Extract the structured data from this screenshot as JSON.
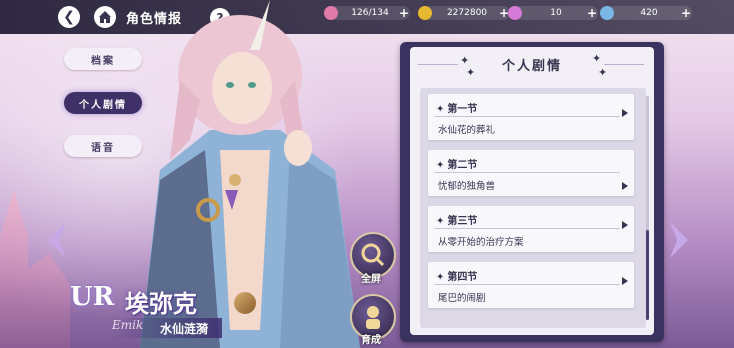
{
  "header": {
    "title": "角色情报",
    "back_icon": "back-arrow-icon",
    "home_icon": "home-icon",
    "help_label": "?"
  },
  "resources": [
    {
      "icon": "candy-icon",
      "value": "126/134",
      "color": "#e07aa8"
    },
    {
      "icon": "coin-icon",
      "value": "2272800",
      "color": "#e6b830"
    },
    {
      "icon": "gem-pink-icon",
      "value": "10",
      "color": "#d67ad8"
    },
    {
      "icon": "diamond-icon",
      "value": "420",
      "color": "#7ab6e6"
    }
  ],
  "side_menu": {
    "items": [
      {
        "label": "档案",
        "active": false
      },
      {
        "label": "个人剧情",
        "active": true
      },
      {
        "label": "语音",
        "active": false
      }
    ]
  },
  "character": {
    "rarity": "UR",
    "name": "埃弥克",
    "signature": "Emik",
    "title": "水仙涟漪"
  },
  "actions": {
    "fullscreen_label": "全屏",
    "upgrade_label": "育成"
  },
  "story_panel": {
    "title": "个人剧情",
    "chapters": [
      {
        "chapter": "第一节",
        "name": "水仙花的葬礼"
      },
      {
        "chapter": "第二节",
        "name": "忧郁的独角兽"
      },
      {
        "chapter": "第三节",
        "name": "从零开始的治疗方案"
      },
      {
        "chapter": "第四节",
        "name": "尾巴的闹剧"
      }
    ]
  },
  "colors": {
    "accent_dark": "#3a3360",
    "accent_purple": "#3f3167",
    "panel_bg": "#f2f0f6"
  }
}
